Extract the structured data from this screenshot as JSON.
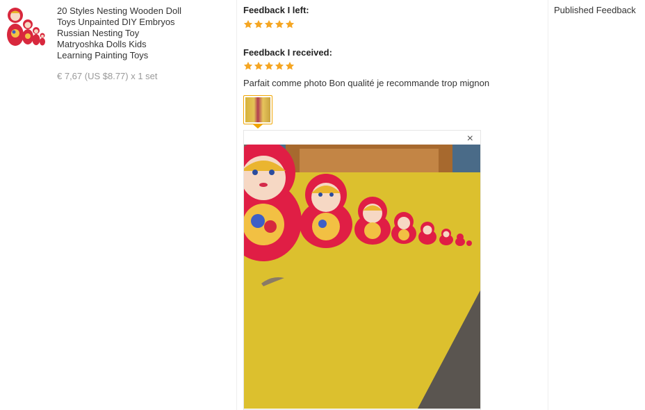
{
  "product": {
    "thumbnail_icon": "matryoshka-dolls-thumbnail",
    "title": "20 Styles Nesting Wooden Doll Toys Unpainted DIY Embryos Russian Nesting Toy Matryoshka Dolls Kids Learning Painting Toys",
    "price": "€ 7,67 (US $8.77) x 1 set"
  },
  "feedback": {
    "left_heading": "Feedback I left:",
    "left_stars": 5,
    "received_heading": "Feedback I received:",
    "received_stars": 5,
    "comment": "Parfait comme photo Bon qualité je recommande trop mignon",
    "close_icon": "close-icon",
    "close_glyph": "×"
  },
  "status": {
    "label": "Published Feedback"
  },
  "colors": {
    "star": "#f5a623",
    "accent": "#f0a500"
  }
}
